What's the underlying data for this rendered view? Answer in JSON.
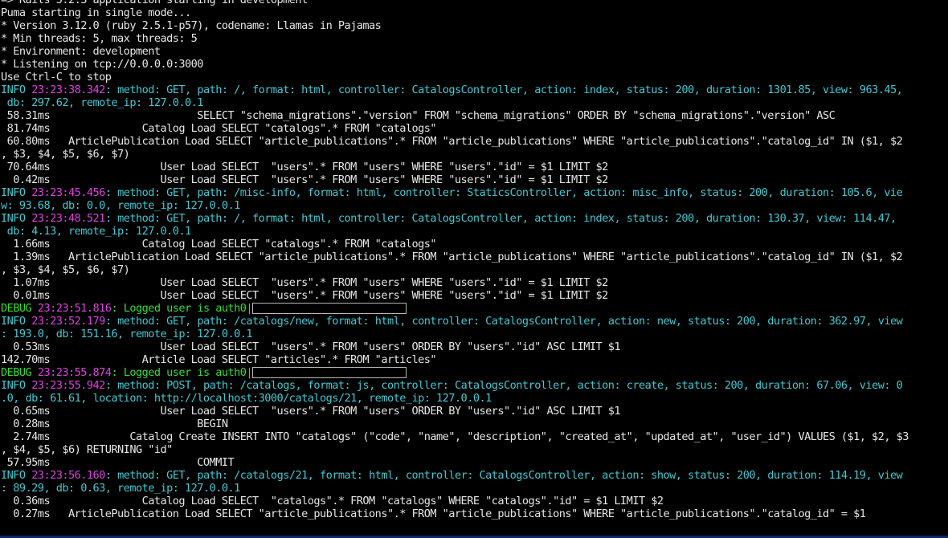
{
  "terminal": {
    "colors": {
      "background": "#000000",
      "default_text": "#c0c0c0",
      "info": "#3fc9d3",
      "debug": "#33dd33",
      "timestamp": "#e040e0"
    },
    "lines": [
      {
        "kind": "text",
        "text": "=> Rails 5.2.3 application starting in development"
      },
      {
        "kind": "text",
        "text": "Puma starting in single mode..."
      },
      {
        "kind": "text",
        "text": "* Version 3.12.0 (ruby 2.5.1-p57), codename: Llamas in Pajamas"
      },
      {
        "kind": "text",
        "text": "* Min threads: 5, max threads: 5"
      },
      {
        "kind": "text",
        "text": "* Environment: development"
      },
      {
        "kind": "text",
        "text": "* Listening on tcp://0.0.0.0:3000"
      },
      {
        "kind": "text",
        "text": "Use Ctrl-C to stop"
      },
      {
        "kind": "log",
        "level": "INFO",
        "time": "23:23:38.342",
        "msg": ": method: GET, path: /, format: html, controller: CatalogsController, action: index, status: 200, duration: 1301.85, view: 963.45,"
      },
      {
        "kind": "cont",
        "text": " db: 297.62, remote_ip: 127.0.0.1"
      },
      {
        "kind": "sql",
        "text": " 58.31ms                        SELECT \"schema_migrations\".\"version\" FROM \"schema_migrations\" ORDER BY \"schema_migrations\".\"version\" ASC"
      },
      {
        "kind": "sql",
        "text": " 81.74ms               Catalog Load SELECT \"catalogs\".* FROM \"catalogs\""
      },
      {
        "kind": "sql",
        "text": " 60.80ms   ArticlePublication Load SELECT \"article_publications\".* FROM \"article_publications\" WHERE \"article_publications\".\"catalog_id\" IN ($1, $2"
      },
      {
        "kind": "sql",
        "text": ", $3, $4, $5, $6, $7)"
      },
      {
        "kind": "sql",
        "text": " 70.64ms                  User Load SELECT  \"users\".* FROM \"users\" WHERE \"users\".\"id\" = $1 LIMIT $2"
      },
      {
        "kind": "sql",
        "text": "  0.42ms                  User Load SELECT  \"users\".* FROM \"users\" WHERE \"users\".\"id\" = $1 LIMIT $2"
      },
      {
        "kind": "log",
        "level": "INFO",
        "time": "23:23:45.456",
        "msg": ": method: GET, path: /misc-info, format: html, controller: StaticsController, action: misc_info, status: 200, duration: 105.6, vie"
      },
      {
        "kind": "cont",
        "text": "w: 93.68, db: 0.0, remote_ip: 127.0.0.1"
      },
      {
        "kind": "log",
        "level": "INFO",
        "time": "23:23:48.521",
        "msg": ": method: GET, path: /, format: html, controller: CatalogsController, action: index, status: 200, duration: 130.37, view: 114.47,"
      },
      {
        "kind": "cont",
        "text": " db: 4.13, remote_ip: 127.0.0.1"
      },
      {
        "kind": "sql",
        "text": "  1.66ms               Catalog Load SELECT \"catalogs\".* FROM \"catalogs\""
      },
      {
        "kind": "sql",
        "text": "  1.39ms   ArticlePublication Load SELECT \"article_publications\".* FROM \"article_publications\" WHERE \"article_publications\".\"catalog_id\" IN ($1, $2"
      },
      {
        "kind": "sql",
        "text": ", $3, $4, $5, $6, $7)"
      },
      {
        "kind": "sql",
        "text": "  1.07ms                  User Load SELECT  \"users\".* FROM \"users\" WHERE \"users\".\"id\" = $1 LIMIT $2"
      },
      {
        "kind": "sql",
        "text": "  0.01ms                  User Load SELECT  \"users\".* FROM \"users\" WHERE \"users\".\"id\" = $1 LIMIT $2"
      },
      {
        "kind": "debug",
        "level": "DEBUG",
        "time": "23:23:51.816",
        "msg": ": Logged user is auth0|"
      },
      {
        "kind": "log",
        "level": "INFO",
        "time": "23:23:52.179",
        "msg": ": method: GET, path: /catalogs/new, format: html, controller: CatalogsController, action: new, status: 200, duration: 362.97, view"
      },
      {
        "kind": "cont",
        "text": ": 193.0, db: 151.16, remote_ip: 127.0.0.1"
      },
      {
        "kind": "sql",
        "text": "  0.53ms                  User Load SELECT  \"users\".* FROM \"users\" ORDER BY \"users\".\"id\" ASC LIMIT $1"
      },
      {
        "kind": "sql",
        "text": "142.70ms               Article Load SELECT \"articles\".* FROM \"articles\""
      },
      {
        "kind": "debug",
        "level": "DEBUG",
        "time": "23:23:55.874",
        "msg": ": Logged user is auth0|"
      },
      {
        "kind": "log",
        "level": "INFO",
        "time": "23:23:55.942",
        "msg": ": method: POST, path: /catalogs, format: js, controller: CatalogsController, action: create, status: 200, duration: 67.06, view: 0"
      },
      {
        "kind": "cont",
        "text": ".0, db: 61.61, location: http://localhost:3000/catalogs/21, remote_ip: 127.0.0.1"
      },
      {
        "kind": "sql",
        "text": "  0.65ms                  User Load SELECT  \"users\".* FROM \"users\" ORDER BY \"users\".\"id\" ASC LIMIT $1"
      },
      {
        "kind": "sql",
        "text": "  0.28ms                        BEGIN"
      },
      {
        "kind": "sql",
        "text": "  2.74ms             Catalog Create INSERT INTO \"catalogs\" (\"code\", \"name\", \"description\", \"created_at\", \"updated_at\", \"user_id\") VALUES ($1, $2, $3"
      },
      {
        "kind": "sql",
        "text": ", $4, $5, $6) RETURNING \"id\""
      },
      {
        "kind": "sql",
        "text": " 57.95ms                        COMMIT"
      },
      {
        "kind": "log",
        "level": "INFO",
        "time": "23:23:56.160",
        "msg": ": method: GET, path: /catalogs/21, format: html, controller: CatalogsController, action: show, status: 200, duration: 114.19, view"
      },
      {
        "kind": "cont",
        "text": ": 89.29, db: 0.63, remote_ip: 127.0.0.1"
      },
      {
        "kind": "sql",
        "text": "  0.36ms               Catalog Load SELECT  \"catalogs\".* FROM \"catalogs\" WHERE \"catalogs\".\"id\" = $1 LIMIT $2"
      },
      {
        "kind": "sql",
        "text": "  0.27ms   ArticlePublication Load SELECT \"article_publications\".* FROM \"article_publications\" WHERE \"article_publications\".\"catalog_id\" = $1"
      }
    ]
  }
}
